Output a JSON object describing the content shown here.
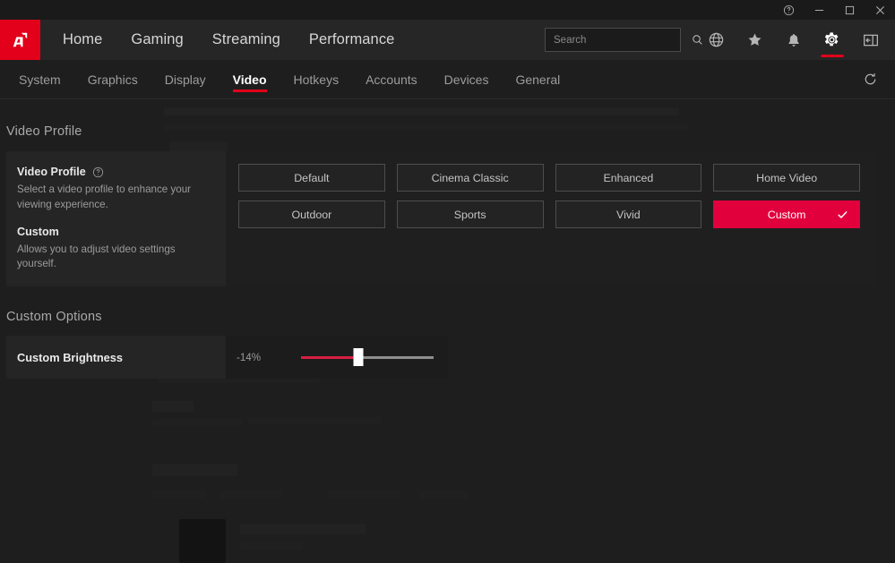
{
  "app": {
    "accent": "#e2001a",
    "selected_accent": "#e2003c"
  },
  "titlebar": {
    "help_label": "Help",
    "minimize_label": "Minimize",
    "maximize_label": "Maximize",
    "close_label": "Close"
  },
  "nav": {
    "logo_alt": "AMD",
    "links": [
      {
        "label": "Home"
      },
      {
        "label": "Gaming"
      },
      {
        "label": "Streaming"
      },
      {
        "label": "Performance"
      }
    ],
    "search": {
      "value": "",
      "placeholder": "Search"
    },
    "icons": [
      {
        "name": "globe-icon",
        "label": "Browser",
        "active": false
      },
      {
        "name": "star-icon",
        "label": "Favorites",
        "active": false
      },
      {
        "name": "bell-icon",
        "label": "Notifications",
        "active": false
      },
      {
        "name": "gear-icon",
        "label": "Settings",
        "active": true
      },
      {
        "name": "panel-toggle-icon",
        "label": "Sign In",
        "active": false
      }
    ]
  },
  "tabs": {
    "items": [
      {
        "label": "System",
        "active": false
      },
      {
        "label": "Graphics",
        "active": false
      },
      {
        "label": "Display",
        "active": false
      },
      {
        "label": "Video",
        "active": true
      },
      {
        "label": "Hotkeys",
        "active": false
      },
      {
        "label": "Accounts",
        "active": false
      },
      {
        "label": "Devices",
        "active": false
      },
      {
        "label": "General",
        "active": false
      }
    ],
    "reset_label": "Reset"
  },
  "main": {
    "video_profile_section": {
      "title": "Video Profile",
      "option_title": "Video Profile",
      "option_desc": "Select a video profile to enhance your viewing experience.",
      "custom_title": "Custom",
      "custom_desc": "Allows you to adjust video settings yourself.",
      "profiles": [
        {
          "label": "Default",
          "selected": false
        },
        {
          "label": "Cinema Classic",
          "selected": false
        },
        {
          "label": "Enhanced",
          "selected": false
        },
        {
          "label": "Home Video",
          "selected": false
        },
        {
          "label": "Outdoor",
          "selected": false
        },
        {
          "label": "Sports",
          "selected": false
        },
        {
          "label": "Vivid",
          "selected": false
        },
        {
          "label": "Custom",
          "selected": true
        }
      ]
    },
    "custom_options_section": {
      "title": "Custom Options",
      "brightness": {
        "label": "Custom Brightness",
        "value_text": "-14%",
        "fill_percent": 43
      }
    }
  }
}
